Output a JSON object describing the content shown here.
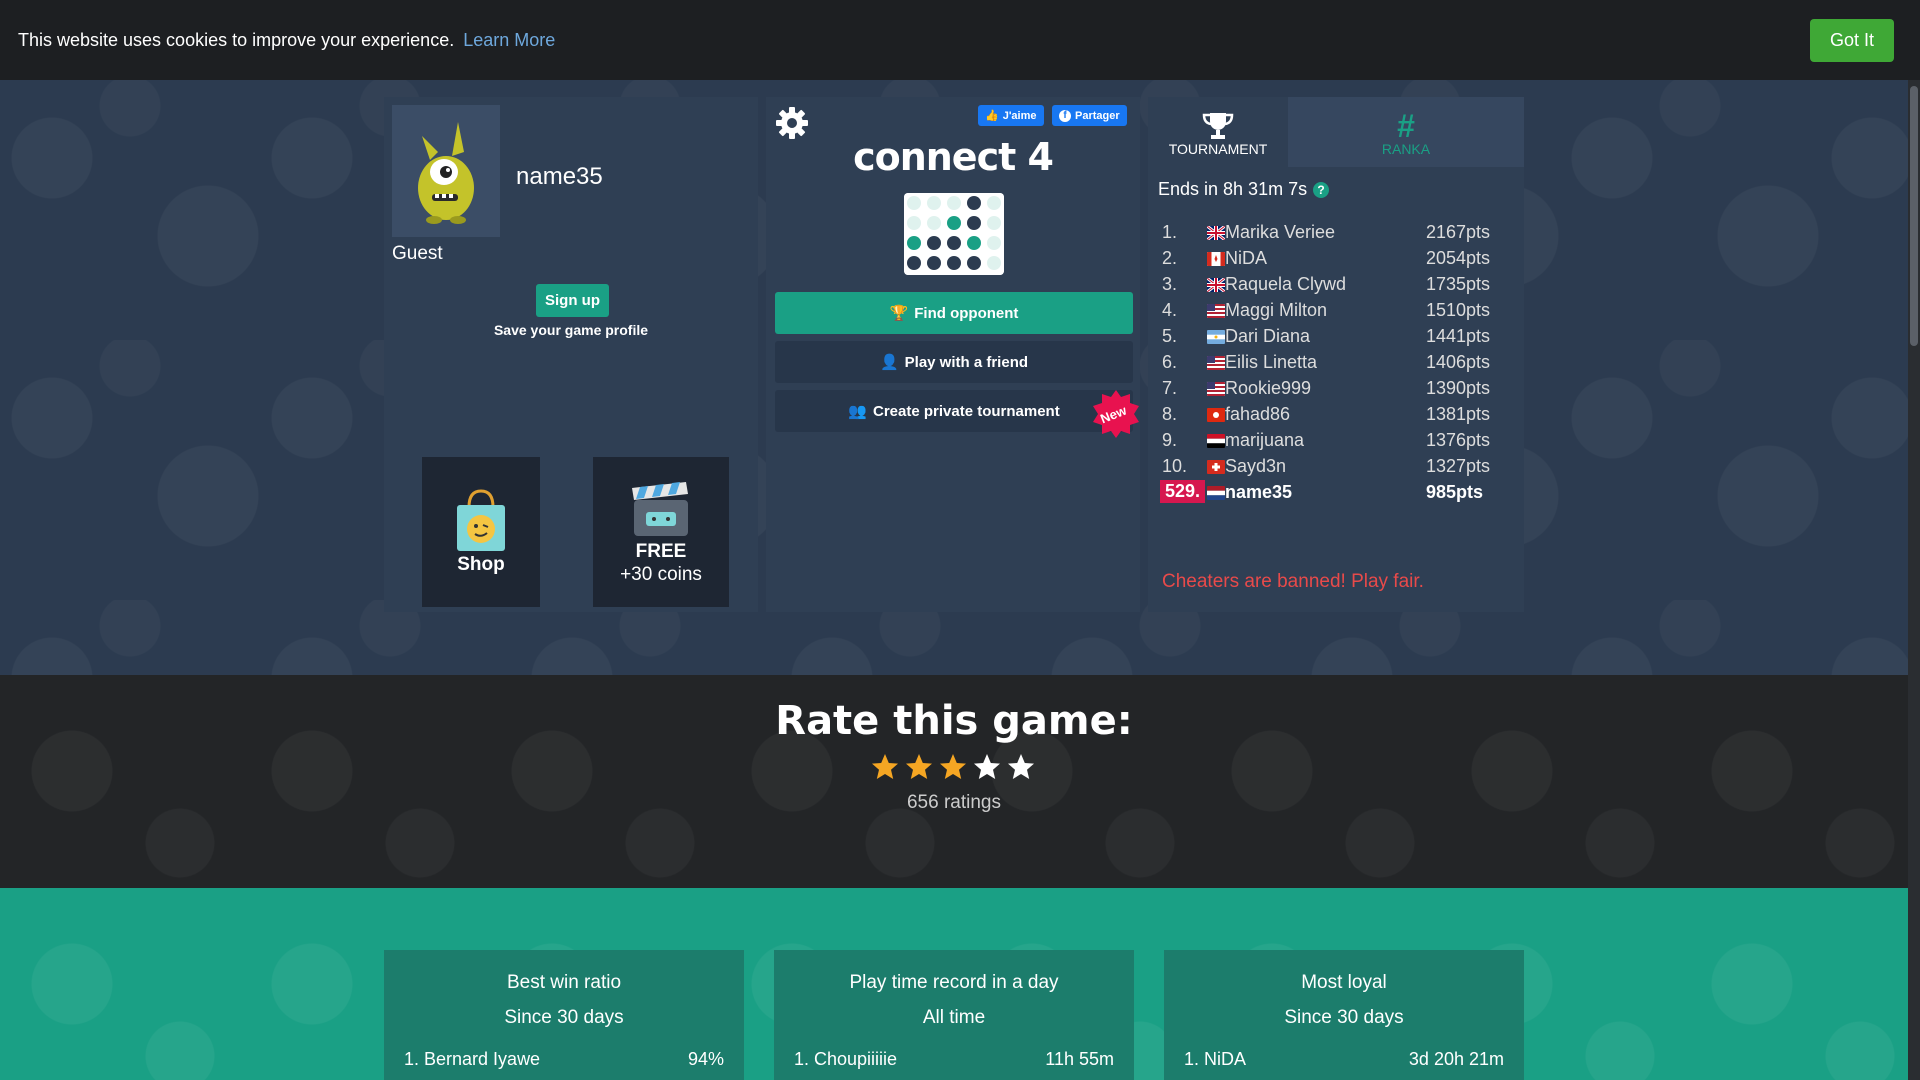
{
  "cookie": {
    "text": "This website uses cookies to improve your experience.",
    "link": "Learn More",
    "button": "Got It"
  },
  "profile": {
    "username": "name35",
    "status": "Guest",
    "signup_label": "Sign up",
    "save_text": "Save your game profile"
  },
  "tiles": {
    "shop_label": "Shop",
    "free_label": "FREE",
    "free_sub": "+30 coins"
  },
  "game": {
    "title": "connect 4",
    "fb_like": "J'aime",
    "fb_share": "Partager",
    "find_opponent": "Find opponent",
    "play_friend": "Play with a friend",
    "private_tournament": "Create private tournament",
    "new_badge": "New"
  },
  "leaderboard": {
    "tab_tournament": "TOURNAMENT",
    "tab_ranka": "RANKA",
    "ends_in": "Ends in 8h 31m 7s",
    "rows": [
      {
        "rank": "1.",
        "name": "Marika Veriee",
        "pts": "2167pts",
        "flag": "uk"
      },
      {
        "rank": "2.",
        "name": "NiDA",
        "pts": "2054pts",
        "flag": "ca"
      },
      {
        "rank": "3.",
        "name": "Raquela Clywd",
        "pts": "1735pts",
        "flag": "uk"
      },
      {
        "rank": "4.",
        "name": "Maggi Milton",
        "pts": "1510pts",
        "flag": "us"
      },
      {
        "rank": "5.",
        "name": "Dari Diana",
        "pts": "1441pts",
        "flag": "ar"
      },
      {
        "rank": "6.",
        "name": "Eilis Linetta",
        "pts": "1406pts",
        "flag": "us"
      },
      {
        "rank": "7.",
        "name": "Rookie999",
        "pts": "1390pts",
        "flag": "us"
      },
      {
        "rank": "8.",
        "name": "fahad86",
        "pts": "1381pts",
        "flag": "hk"
      },
      {
        "rank": "9.",
        "name": "marijuana",
        "pts": "1376pts",
        "flag": "eg"
      },
      {
        "rank": "10.",
        "name": "Sayd3n",
        "pts": "1327pts",
        "flag": "ch"
      }
    ],
    "me": {
      "rank": "529.",
      "name": "name35",
      "pts": "985pts",
      "flag": "nl"
    },
    "cheaters": "Cheaters are banned! Play fair."
  },
  "rating": {
    "title": "Rate this game:",
    "stars_filled": 3,
    "stars_total": 5,
    "count": "656 ratings"
  },
  "stats": [
    {
      "title": "Best win ratio",
      "sub": "Since 30 days",
      "name": "1. Bernard Iyawe",
      "value": "94%"
    },
    {
      "title": "Play time record in a day",
      "sub": "All time",
      "name": "1. Choupiiiiie",
      "value": "11h 55m"
    },
    {
      "title": "Most loyal",
      "sub": "Since 30 days",
      "name": "1. NiDA",
      "value": "3d 20h 21m"
    }
  ],
  "colors": {
    "accent": "#1aa085",
    "panel": "#2f3f54",
    "danger": "#e84a4a",
    "badge": "#d6174f",
    "cookie_button": "#3fa836"
  }
}
